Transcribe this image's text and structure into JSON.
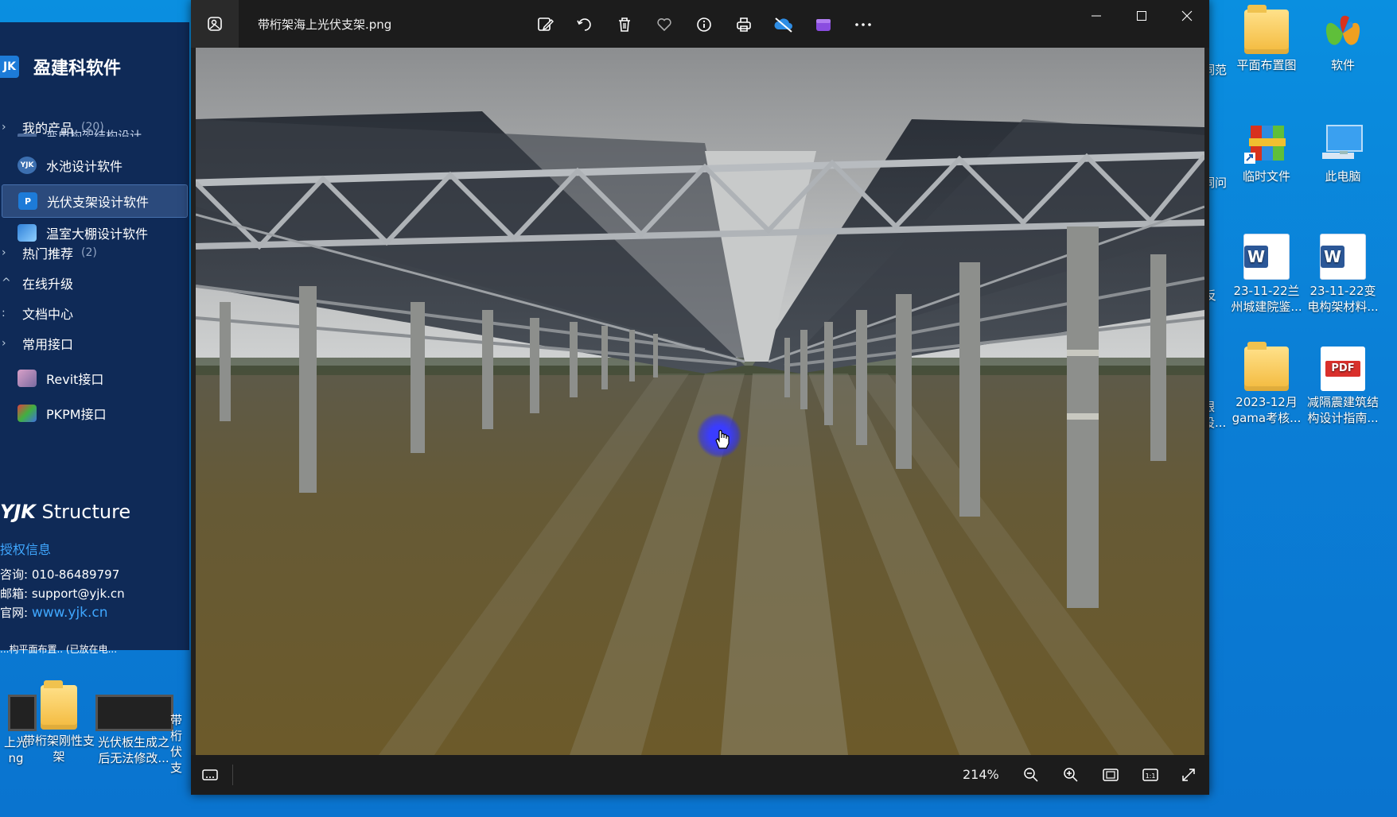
{
  "viewer": {
    "filename": "带桁架海上光伏支架.png",
    "zoom": "214%"
  },
  "yjk_panel": {
    "logo_text": "JK",
    "brand": "盈建科软件",
    "group_products": {
      "label": "我的产品",
      "count": "(20)"
    },
    "cut_item": "变电构架结构设计...",
    "items": [
      {
        "label": "水池设计软件",
        "icon_text": "YJK"
      },
      {
        "label": "光伏支架设计软件",
        "icon_text": "P"
      },
      {
        "label": "温室大棚设计软件",
        "icon_text": ""
      }
    ],
    "group_hot": {
      "label": "热门推荐",
      "count": "(2)"
    },
    "links": [
      "在线升级",
      "文档中心",
      "常用接口"
    ],
    "interfaces": [
      "Revit接口",
      "PKPM接口"
    ],
    "struct_bold": "YJK",
    "struct_text": " Structure",
    "license": "授权信息",
    "phone_label": "咨询:",
    "phone": "010-86489797",
    "email_label": "邮箱:",
    "email": "support@yjk.cn",
    "web_label": "官网:",
    "web": "www.yjk.cn"
  },
  "desktop_right": [
    {
      "label": "平面布置图",
      "type": "folder"
    },
    {
      "label": "软件",
      "type": "app"
    },
    {
      "label": "临时文件",
      "type": "app2"
    },
    {
      "label": "此电脑",
      "type": "pc"
    },
    {
      "label": "23-11-22兰州城建院鉴...",
      "type": "word"
    },
    {
      "label": "23-11-22变电构架材料...",
      "type": "word"
    },
    {
      "label": "2023-12月gama考核...",
      "type": "folder"
    },
    {
      "label": "减隔震建筑结构设计指南...",
      "type": "pdf"
    }
  ],
  "desktop_right_partial": [
    "词范",
    "词问",
    "反",
    "银设..."
  ],
  "desktop_bottom": [
    {
      "label": "上光ng",
      "type": "video"
    },
    {
      "label": "带桁架刚性支架",
      "type": "folder"
    },
    {
      "label": "光伏板生成之后无法修改...",
      "type": "video"
    },
    {
      "label": "带桁伏支",
      "type": "folder"
    }
  ],
  "desktop_bottom_partial_top": "...构平面布置.. (已放在电...",
  "colors": {
    "desktop": "#0a86dc",
    "panel": "#0f2a57",
    "accent": "#3fa7ff",
    "cursor": "#3a3cff"
  }
}
